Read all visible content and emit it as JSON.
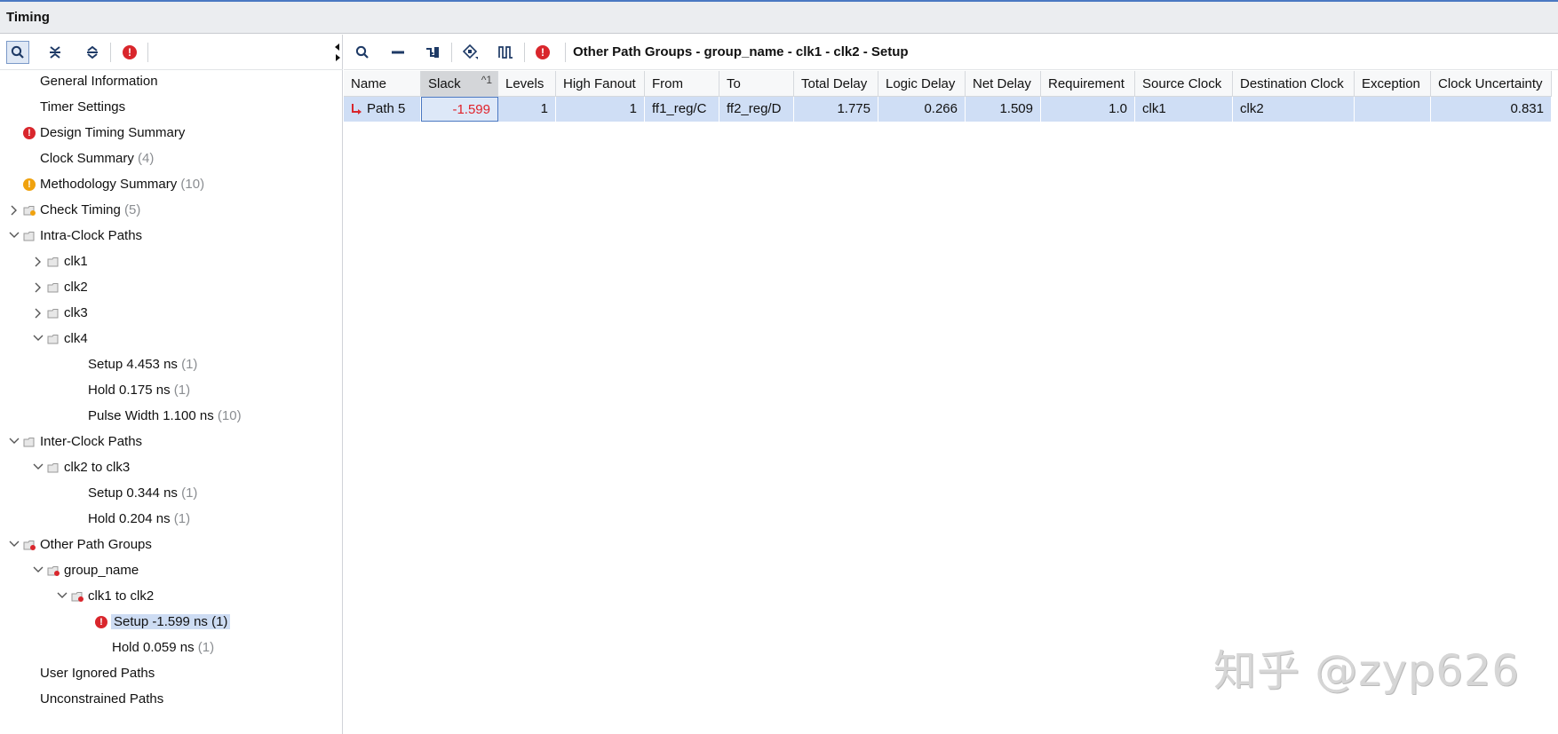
{
  "window": {
    "title": "Timing"
  },
  "colors": {
    "accent": "#4a78c2",
    "error": "#d9262c",
    "warning": "#f0a20e",
    "selection": "#cfdef5",
    "negative_slack": "#e0222a"
  },
  "left_toolbar": {
    "icons": [
      "search-icon",
      "collapse-all-icon",
      "expand-all-icon",
      "error-icon"
    ]
  },
  "tree": {
    "general_information": "General Information",
    "timer_settings": "Timer Settings",
    "design_timing_summary": "Design Timing Summary",
    "clock_summary": "Clock Summary",
    "clock_summary_count": "(4)",
    "methodology_summary": "Methodology Summary",
    "methodology_summary_count": "(10)",
    "check_timing": "Check Timing",
    "check_timing_count": "(5)",
    "intra_clock_paths": "Intra-Clock Paths",
    "clk1": "clk1",
    "clk2": "clk2",
    "clk3": "clk3",
    "clk4": "clk4",
    "clk4_setup": "Setup 4.453 ns",
    "clk4_setup_count": "(1)",
    "clk4_hold": "Hold 0.175 ns",
    "clk4_hold_count": "(1)",
    "clk4_pulse": "Pulse Width 1.100 ns",
    "clk4_pulse_count": "(10)",
    "inter_clock_paths": "Inter-Clock Paths",
    "clk2_to_clk3": "clk2 to clk3",
    "inter_setup": "Setup 0.344 ns",
    "inter_setup_count": "(1)",
    "inter_hold": "Hold 0.204 ns",
    "inter_hold_count": "(1)",
    "other_path_groups": "Other Path Groups",
    "group_name": "group_name",
    "clk1_to_clk2": "clk1 to clk2",
    "group_setup": "Setup -1.599 ns (1)",
    "group_hold": "Hold 0.059 ns",
    "group_hold_count": "(1)",
    "user_ignored_paths": "User Ignored Paths",
    "unconstrained_paths": "Unconstrained Paths"
  },
  "right_toolbar": {
    "icons": [
      "search-icon",
      "minimize-icon",
      "route-icon",
      "schematic-icon",
      "waveform-icon",
      "error-icon"
    ],
    "breadcrumb": "Other Path Groups - group_name - clk1 - clk2 - Setup"
  },
  "table": {
    "columns": {
      "name": "Name",
      "slack": "Slack",
      "slack_sort": "^1",
      "levels": "Levels",
      "high_fanout": "High Fanout",
      "from": "From",
      "to": "To",
      "total_delay": "Total Delay",
      "logic_delay": "Logic Delay",
      "net_delay": "Net Delay",
      "requirement": "Requirement",
      "source_clock": "Source Clock",
      "destination_clock": "Destination Clock",
      "exception": "Exception",
      "clock_uncertainty": "Clock Uncertainty"
    },
    "rows": [
      {
        "name": "Path 5",
        "slack": "-1.599",
        "levels": "1",
        "high_fanout": "1",
        "from": "ff1_reg/C",
        "to": "ff2_reg/D",
        "total_delay": "1.775",
        "logic_delay": "0.266",
        "net_delay": "1.509",
        "requirement": "1.0",
        "source_clock": "clk1",
        "destination_clock": "clk2",
        "exception": "",
        "clock_uncertainty": "0.831"
      }
    ]
  },
  "watermark": "知乎 @zyp626"
}
